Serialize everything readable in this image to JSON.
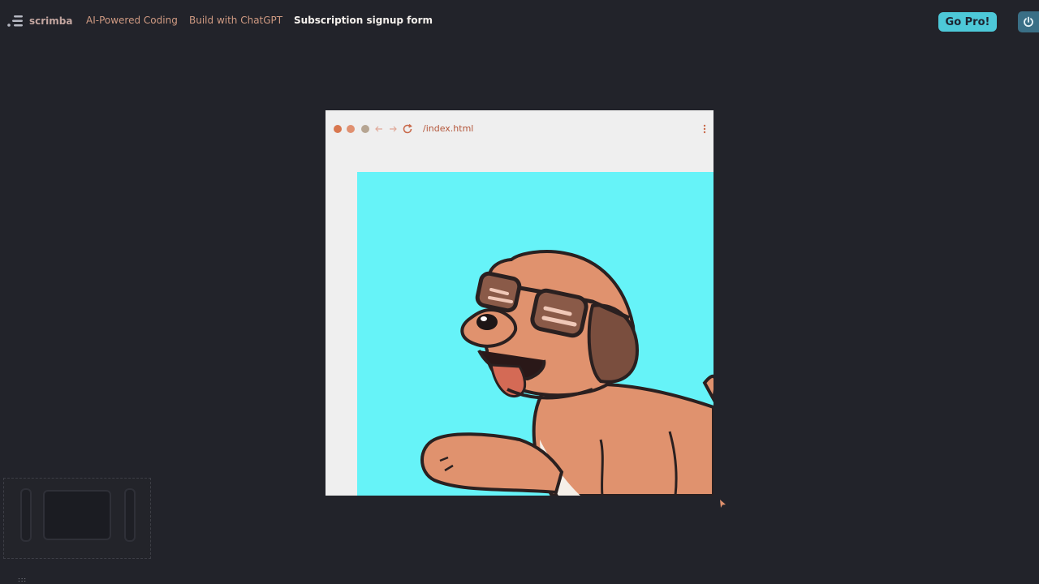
{
  "header": {
    "logo_text": "scrimba",
    "breadcrumbs": [
      {
        "label": "AI-Powered Coding"
      },
      {
        "label": "Build with ChatGPT"
      },
      {
        "label": "Subscription signup form"
      }
    ],
    "go_pro_label": "Go Pro!"
  },
  "browser": {
    "url": "/index.html",
    "window_dot_colors": [
      "#d8774f",
      "#e09070",
      "#b6a592"
    ],
    "preview_background": "#66f3f8",
    "preview_image": "dog-wearing-sunglasses-illustration"
  },
  "icons": {
    "logo": "scrimba-logo-icon",
    "power": "power-icon",
    "back": "arrow-left-icon",
    "forward": "arrow-right-icon",
    "reload": "reload-icon",
    "menu": "kebab-menu-icon"
  },
  "colors": {
    "background": "#22232a",
    "accent": "#4dc8d8",
    "breadcrumb": "#cf9a82"
  }
}
